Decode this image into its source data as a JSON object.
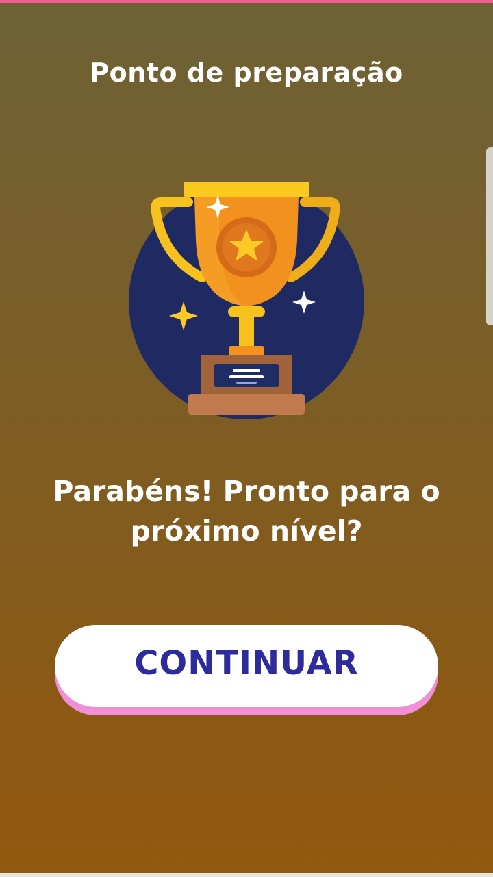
{
  "header": {
    "title": "Ponto de preparação"
  },
  "trophy": {
    "icon": "trophy-icon",
    "accent_colors": {
      "circle": "#1f2a63",
      "cup": "#f2911e",
      "handles": "#f7c21e",
      "star": "#ffc928",
      "base": "#a1633a"
    }
  },
  "main": {
    "message": "Parabéns! Pronto para o próximo nível?"
  },
  "actions": {
    "continue_label": "CONTINUAR"
  },
  "colors": {
    "top_accent": "#ee5e93",
    "button_text": "#2e2b9a",
    "button_shadow": "#f08fd6"
  }
}
